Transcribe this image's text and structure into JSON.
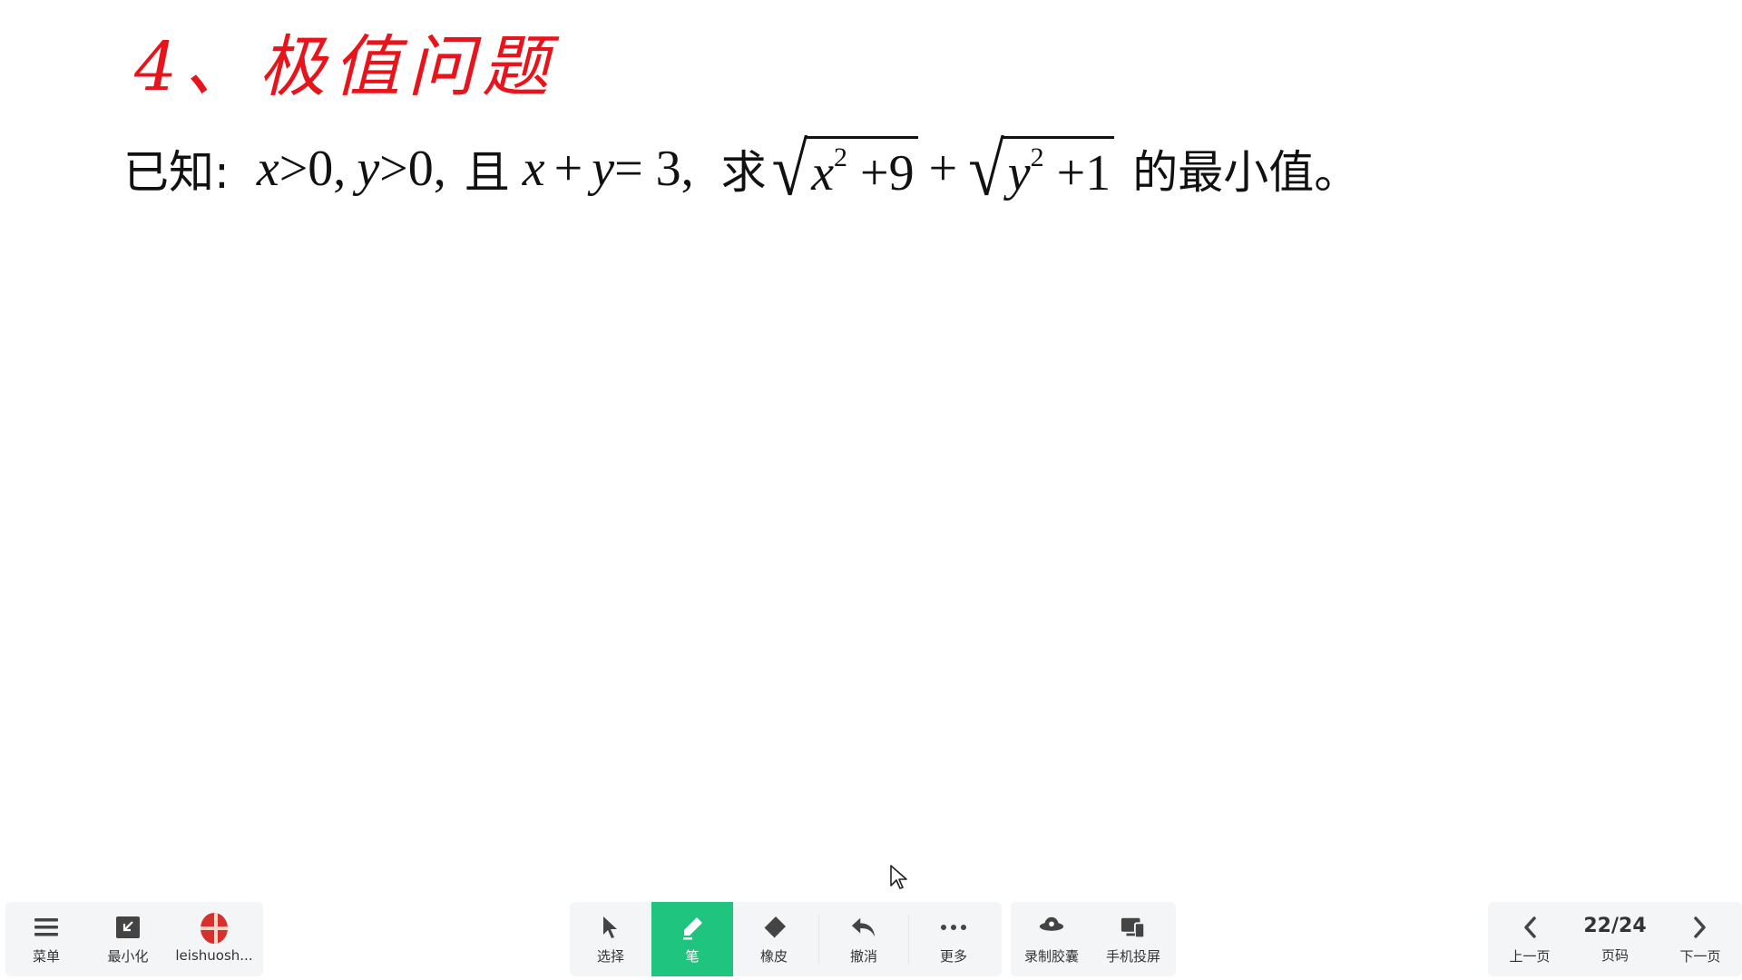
{
  "slide": {
    "title": "4、极值问题",
    "problem": {
      "prefix": "已知:",
      "cond1_var": "x",
      "cond1_rest": " >0,",
      "cond2_var": "y",
      "cond2_rest": " >0,",
      "conj": "且",
      "sum_x": "x",
      "plus": "+",
      "sum_y": "y",
      "eq": " = 3,",
      "ask": "求",
      "sqrt1_var": "x",
      "sqrt1_exp": "2",
      "sqrt1_tail": " +9",
      "mid_plus": "+",
      "sqrt2_var": "y",
      "sqrt2_exp": "2",
      "sqrt2_tail": " +1",
      "suffix": "的最小值。"
    }
  },
  "toolbar": {
    "left": [
      {
        "label": "菜单",
        "icon": "menu-icon"
      },
      {
        "label": "最小化",
        "icon": "minimize-icon"
      },
      {
        "label": "leishuosh...",
        "icon": "avatar"
      }
    ],
    "center": [
      {
        "label": "选择",
        "icon": "pointer-icon"
      },
      {
        "label": "笔",
        "icon": "pen-icon",
        "active": true
      },
      {
        "label": "橡皮",
        "icon": "eraser-icon"
      },
      {
        "label": "撤消",
        "icon": "undo-icon"
      },
      {
        "label": "更多",
        "icon": "more-icon"
      }
    ],
    "center_right": [
      {
        "label": "录制胶囊",
        "icon": "record-icon"
      },
      {
        "label": "手机投屏",
        "icon": "phone-cast-icon"
      }
    ],
    "right": {
      "prev_label": "上一页",
      "page_value": "22/24",
      "page_label": "页码",
      "next_label": "下一页"
    }
  },
  "colors": {
    "title_red": "#e8141c",
    "active_green": "#1fc47e",
    "toolbar_bg": "#f4f5f6"
  }
}
